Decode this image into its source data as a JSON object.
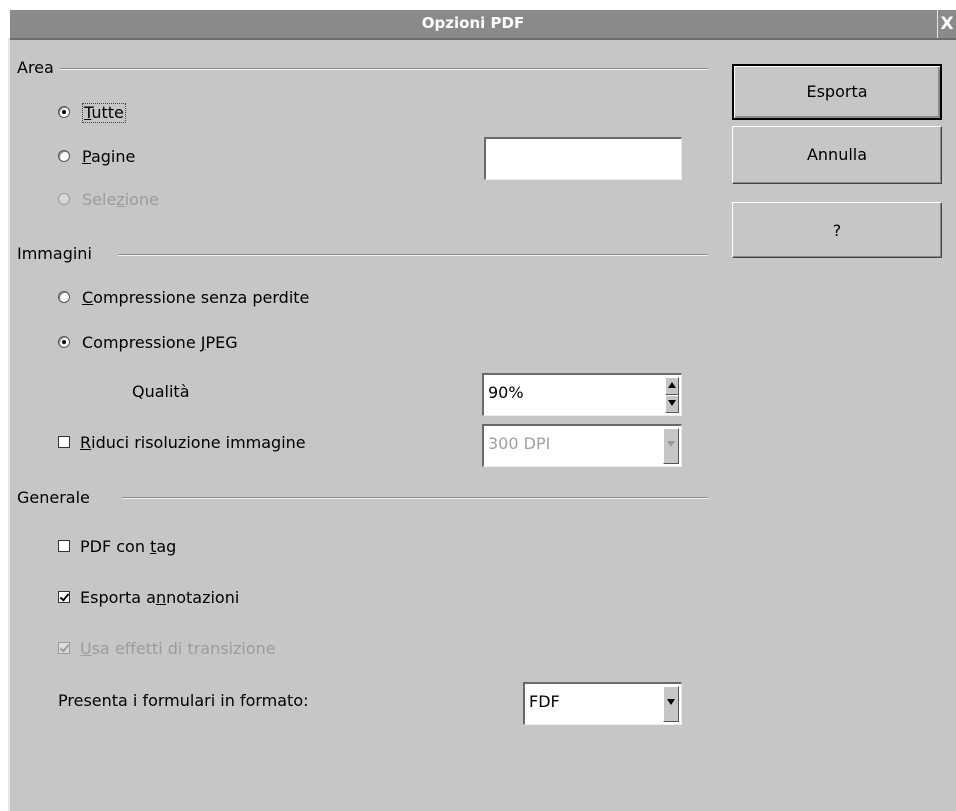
{
  "window": {
    "title": "Opzioni PDF",
    "close_glyph": "X"
  },
  "area": {
    "label": "Area",
    "options": [
      {
        "label": "Tutte",
        "checked": true,
        "disabled": false
      },
      {
        "label": "Pagine",
        "checked": false,
        "disabled": false
      },
      {
        "label": "Selezione",
        "checked": false,
        "disabled": true
      }
    ],
    "pages_value": ""
  },
  "immagini": {
    "label": "Immagini",
    "lossless_label": "Compressione senza perdite",
    "jpeg_label": "Compressione JPEG",
    "quality_label": "Qualità",
    "quality_value": "90%",
    "reduce_label": "Riduci risoluzione immagine",
    "resolution_value": "300 DPI"
  },
  "generale": {
    "label": "Generale",
    "tagged_label": "PDF con tag",
    "export_notes_label": "Esporta annotazioni",
    "transitions_label": "Usa effetti di transizione",
    "form_format_label": "Presenta i formulari in formato:",
    "form_format_value": "FDF"
  },
  "buttons": {
    "export": "Esporta",
    "cancel": "Annulla",
    "help": "?"
  }
}
